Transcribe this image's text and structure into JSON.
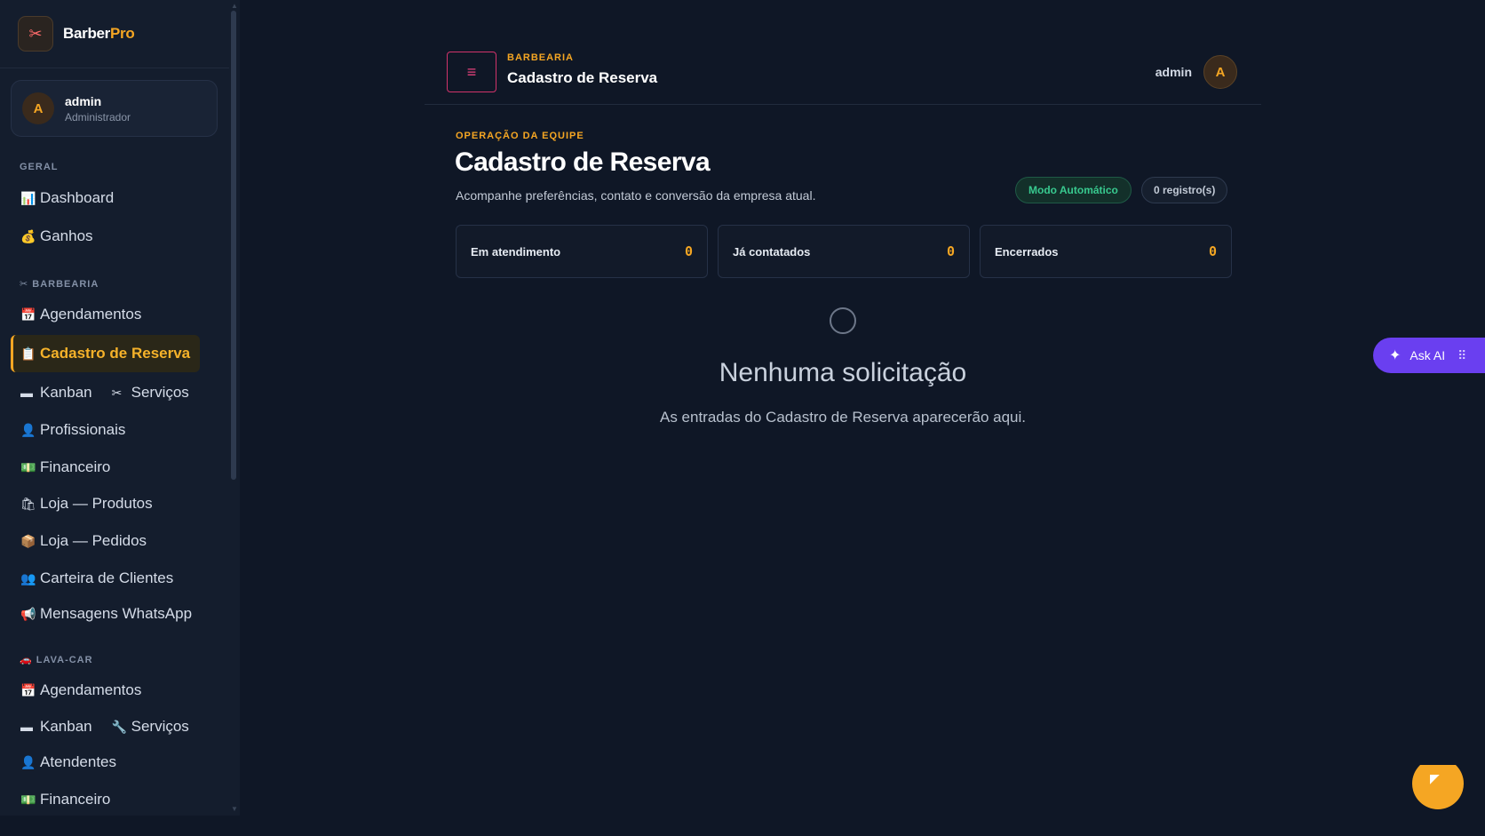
{
  "brand": {
    "name_main": "Barber",
    "name_accent": "Pro",
    "logo_icon": "scissors-icon"
  },
  "user_card": {
    "initial": "A",
    "name": "admin",
    "role": "Administrador"
  },
  "sidebar": {
    "section_geral": "GERAL",
    "dashboard": {
      "icon": "📊",
      "label": "Dashboard"
    },
    "ganhos": {
      "icon": "💰",
      "label": "Ganhos"
    },
    "section_barbearia": "✂ BARBEARIA",
    "agendamentos": {
      "icon": "📅",
      "label": "Agendamentos"
    },
    "cadastro": {
      "icon": "📋",
      "label": "Cadastro de Reserva"
    },
    "kanban": {
      "icon": "▬",
      "label": "Kanban"
    },
    "servicos": {
      "icon": "✂",
      "label": "Serviços"
    },
    "profissionais": {
      "icon": "👤",
      "label": "Profissionais"
    },
    "financeiro": {
      "icon": "💵",
      "label": "Financeiro"
    },
    "loja_produtos": {
      "icon": "🛍",
      "label": "Loja — Produtos"
    },
    "loja_pedidos": {
      "icon": "📦",
      "label": "Loja — Pedidos"
    },
    "carteira": {
      "icon": "👥",
      "label": "Carteira de Clientes"
    },
    "mensagens": {
      "icon": "📢",
      "label": "Mensagens WhatsApp"
    },
    "section_lavacar": "🚗 LAVA-CAR",
    "lc_agendamentos": {
      "icon": "📅",
      "label": "Agendamentos"
    },
    "lc_kanban": {
      "icon": "▬",
      "label": "Kanban"
    },
    "lc_servicos": {
      "icon": "🔧",
      "label": "Serviços"
    },
    "lc_atendentes": {
      "icon": "👤",
      "label": "Atendentes"
    },
    "lc_financeiro": {
      "icon": "💵",
      "label": "Financeiro"
    }
  },
  "topbar": {
    "menu_icon": "≡",
    "eyebrow": "BARBEARIA",
    "title": "Cadastro de Reserva",
    "user": "admin",
    "initial": "A"
  },
  "main": {
    "eyebrow": "OPERAÇÃO DA EQUIPE",
    "title": "Cadastro de Reserva",
    "subtitle": "Acompanhe preferências, contato e conversão da empresa atual.",
    "badge_mode": "Modo Automático",
    "badge_count": "0 registro(s)",
    "stats": [
      {
        "label": "Em atendimento",
        "value": "0"
      },
      {
        "label": "Já contatados",
        "value": "0"
      },
      {
        "label": "Encerrados",
        "value": "0"
      }
    ],
    "empty_title": "Nenhuma solicitação",
    "empty_subtitle": "As entradas do Cadastro de Reserva aparecerão aqui."
  },
  "ask_ai": {
    "label": "Ask AI"
  },
  "colors": {
    "accent": "#f5a623",
    "background": "#0f1726",
    "sidebar": "#141d2d",
    "ask_ai": "#6a3ff0",
    "mode_badge": "#38c98f"
  }
}
